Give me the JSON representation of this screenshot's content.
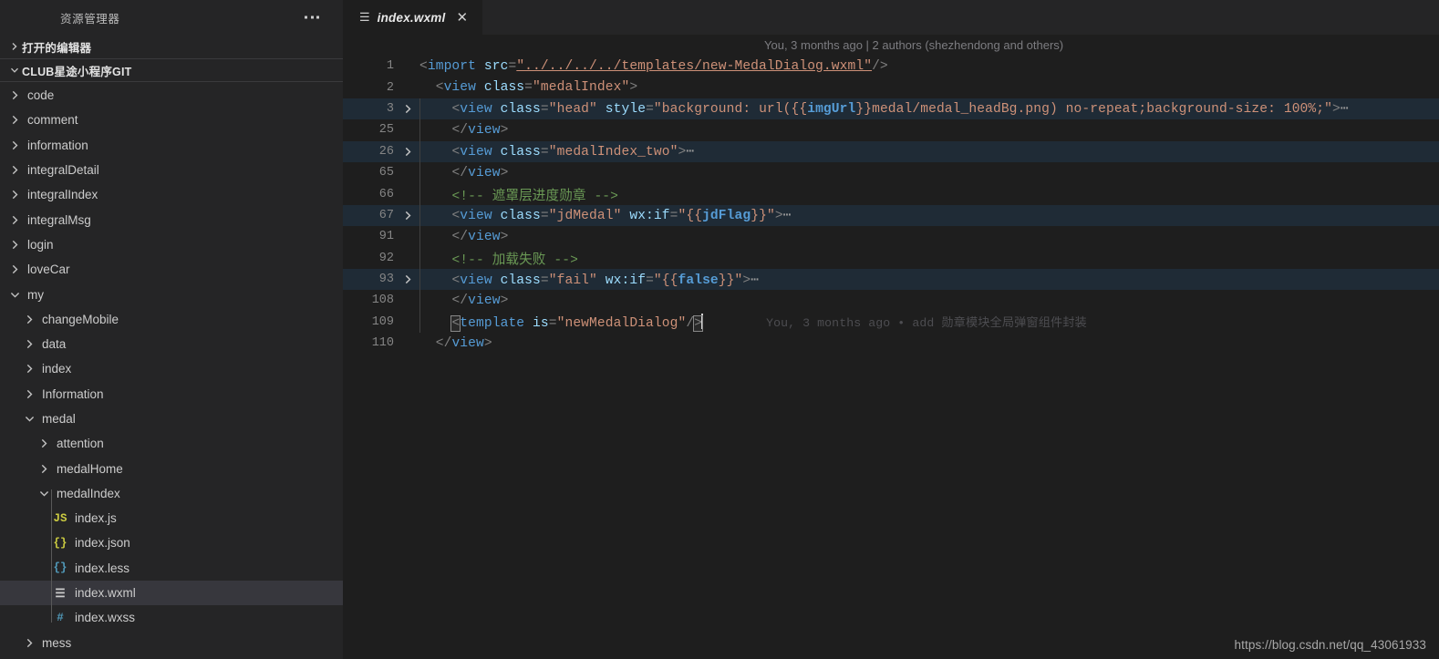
{
  "sidebar": {
    "title": "资源管理器",
    "ellipsis_label": "...",
    "sections": [
      {
        "label": "打开的编辑器",
        "expanded": false
      },
      {
        "label": "CLUB星途小程序GIT",
        "expanded": true
      }
    ],
    "tree": [
      {
        "label": "code",
        "depth": 1,
        "type": "folder",
        "expanded": false,
        "selected": false
      },
      {
        "label": "comment",
        "depth": 1,
        "type": "folder",
        "expanded": false,
        "selected": false
      },
      {
        "label": "information",
        "depth": 1,
        "type": "folder",
        "expanded": false,
        "selected": false
      },
      {
        "label": "integralDetail",
        "depth": 1,
        "type": "folder",
        "expanded": false,
        "selected": false
      },
      {
        "label": "integralIndex",
        "depth": 1,
        "type": "folder",
        "expanded": false,
        "selected": false
      },
      {
        "label": "integralMsg",
        "depth": 1,
        "type": "folder",
        "expanded": false,
        "selected": false
      },
      {
        "label": "login",
        "depth": 1,
        "type": "folder",
        "expanded": false,
        "selected": false
      },
      {
        "label": "loveCar",
        "depth": 1,
        "type": "folder",
        "expanded": false,
        "selected": false
      },
      {
        "label": "my",
        "depth": 1,
        "type": "folder",
        "expanded": true,
        "selected": false
      },
      {
        "label": "changeMobile",
        "depth": 2,
        "type": "folder",
        "expanded": false,
        "selected": false
      },
      {
        "label": "data",
        "depth": 2,
        "type": "folder",
        "expanded": false,
        "selected": false
      },
      {
        "label": "index",
        "depth": 2,
        "type": "folder",
        "expanded": false,
        "selected": false
      },
      {
        "label": "Information",
        "depth": 2,
        "type": "folder",
        "expanded": false,
        "selected": false
      },
      {
        "label": "medal",
        "depth": 2,
        "type": "folder",
        "expanded": true,
        "selected": false
      },
      {
        "label": "attention",
        "depth": 3,
        "type": "folder",
        "expanded": false,
        "selected": false
      },
      {
        "label": "medalHome",
        "depth": 3,
        "type": "folder",
        "expanded": false,
        "selected": false
      },
      {
        "label": "medalIndex",
        "depth": 3,
        "type": "folder",
        "expanded": true,
        "selected": false
      },
      {
        "label": "index.js",
        "depth": 4,
        "type": "file",
        "icon": "js",
        "icon_glyph": "JS",
        "selected": false
      },
      {
        "label": "index.json",
        "depth": 4,
        "type": "file",
        "icon": "json",
        "icon_glyph": "{}",
        "selected": false
      },
      {
        "label": "index.less",
        "depth": 4,
        "type": "file",
        "icon": "less",
        "icon_glyph": "{}",
        "selected": false
      },
      {
        "label": "index.wxml",
        "depth": 4,
        "type": "file",
        "icon": "wxml",
        "icon_glyph": "☰",
        "selected": true
      },
      {
        "label": "index.wxss",
        "depth": 4,
        "type": "file",
        "icon": "wxss",
        "icon_glyph": "#",
        "selected": false
      },
      {
        "label": "mess",
        "depth": 2,
        "type": "folder",
        "expanded": false,
        "selected": false
      }
    ]
  },
  "editor": {
    "tab": {
      "icon_glyph": "☰",
      "name": "index.wxml",
      "close_glyph": "✕"
    },
    "blame_header": "You, 3 months ago | 2 authors (shezhendong and others)",
    "inline_blame": "You, 3 months ago • add 勋章模块全局弹窗组件封装",
    "lines": [
      {
        "num": "1",
        "foldable": false,
        "highlight": false
      },
      {
        "num": "2",
        "foldable": false,
        "highlight": false
      },
      {
        "num": "3",
        "foldable": true,
        "highlight": true
      },
      {
        "num": "25",
        "foldable": false,
        "highlight": false
      },
      {
        "num": "26",
        "foldable": true,
        "highlight": true
      },
      {
        "num": "65",
        "foldable": false,
        "highlight": false
      },
      {
        "num": "66",
        "foldable": false,
        "highlight": false
      },
      {
        "num": "67",
        "foldable": true,
        "highlight": true
      },
      {
        "num": "91",
        "foldable": false,
        "highlight": false
      },
      {
        "num": "92",
        "foldable": false,
        "highlight": false
      },
      {
        "num": "93",
        "foldable": true,
        "highlight": true
      },
      {
        "num": "108",
        "foldable": false,
        "highlight": false
      },
      {
        "num": "109",
        "foldable": false,
        "highlight": false
      },
      {
        "num": "110",
        "foldable": false,
        "highlight": false
      }
    ],
    "code": {
      "l1_import_tag": "import",
      "l1_attr": "src",
      "l1_value": "\"../../../../templates/new-MedalDialog.wxml\"",
      "l2_tag": "view",
      "l2_attr": "class",
      "l2_value": "\"medalIndex\"",
      "l3_tag": "view",
      "l3_attr1": "class",
      "l3_value1": "\"head\"",
      "l3_attr2": "style",
      "l3_value_a": "\"background: url({{",
      "l3_mustache": "imgUrl",
      "l3_value_b": "}}medal/medal_headBg.png) no-repeat;background-size: 100%;\"",
      "l25_close": "view",
      "l26_tag": "view",
      "l26_attr": "class",
      "l26_value": "\"medalIndex_two\"",
      "l65_close": "view",
      "l66_comment": "<!-- 遮罩层进度勋章 -->",
      "l67_tag": "view",
      "l67_attr1": "class",
      "l67_value1": "\"jdMedal\"",
      "l67_attr2": "wx:if",
      "l67_value_a": "\"{{",
      "l67_mustache": "jdFlag",
      "l67_value_b": "}}\"",
      "l91_close": "view",
      "l92_comment": "<!-- 加载失败 -->",
      "l93_tag": "view",
      "l93_attr1": "class",
      "l93_value1": "\"fail\"",
      "l93_attr2": "wx:if",
      "l93_value_a": "\"{{",
      "l93_mustache": "false",
      "l93_value_b": "}}\"",
      "l108_close": "view",
      "l109_tag": "template",
      "l109_attr": "is",
      "l109_value": "\"newMedalDialog\"",
      "l110_close": "view",
      "fold_ellipsis": "⋯"
    }
  },
  "watermark": "https://blog.csdn.net/qq_43061933",
  "colors": {
    "editor_bg": "#1e1e1e",
    "sidebar_bg": "#252526",
    "selection_bg": "#37373d",
    "fold_highlight_bg": "#1f2b36",
    "tag": "#569cd6",
    "attr": "#9cdcfe",
    "string": "#ce9178",
    "comment": "#6a9955"
  }
}
